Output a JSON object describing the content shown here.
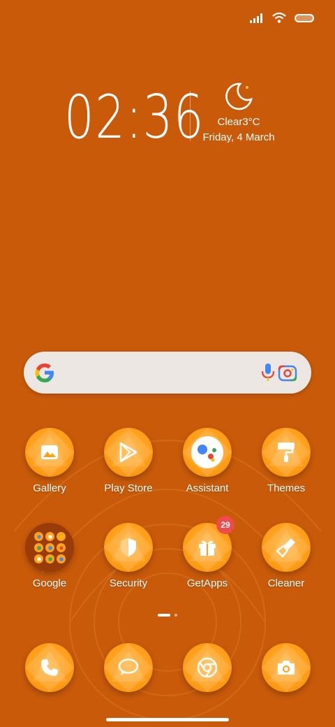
{
  "status_bar": {
    "signal_icon": "signal-icon",
    "wifi_icon": "wifi-icon",
    "battery_icon": "battery-icon"
  },
  "clock": {
    "time": "02:36"
  },
  "weather": {
    "icon": "moon-icon",
    "condition": "Clear3°C",
    "date": "Friday, 4 March"
  },
  "search": {
    "logo": "google-logo-icon",
    "mic_icon": "mic-icon",
    "lens_icon": "lens-icon"
  },
  "apps_row1": [
    {
      "label": "Gallery",
      "icon": "gallery-icon"
    },
    {
      "label": "Play Store",
      "icon": "play-store-icon"
    },
    {
      "label": "Assistant",
      "icon": "assistant-icon"
    },
    {
      "label": "Themes",
      "icon": "themes-icon"
    }
  ],
  "apps_row2": [
    {
      "label": "Google",
      "icon": "google-folder-icon"
    },
    {
      "label": "Security",
      "icon": "security-icon"
    },
    {
      "label": "GetApps",
      "icon": "getapps-icon",
      "badge": "29"
    },
    {
      "label": "Cleaner",
      "icon": "cleaner-icon"
    }
  ],
  "dock": [
    {
      "icon": "phone-icon"
    },
    {
      "icon": "messages-icon"
    },
    {
      "icon": "chrome-icon"
    },
    {
      "icon": "camera-icon"
    }
  ],
  "colors": {
    "background": "#c85a0a",
    "icon_orange": "#ff9f1a",
    "badge_red": "#ee4b4b"
  }
}
